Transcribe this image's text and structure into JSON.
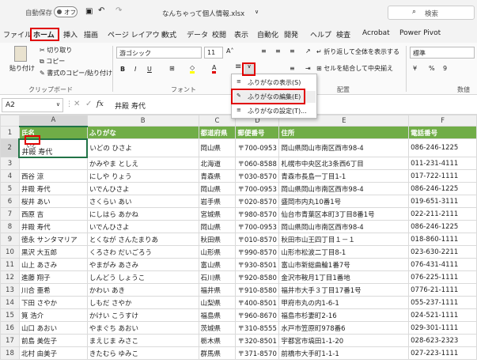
{
  "titlebar": {
    "autosave": "自動保存",
    "autosave_state": "オフ",
    "filename": "なんちゃって個人情報.xlsx",
    "search": "検索"
  },
  "menu": [
    "ファイル",
    "ホーム",
    "挿入",
    "描画",
    "ページ レイアウト",
    "数式",
    "データ",
    "校閲",
    "表示",
    "自動化",
    "開発",
    "ヘルプ",
    "検査",
    "Acrobat",
    "Power Pivot"
  ],
  "ribbon": {
    "paste": "貼り付け",
    "cut": "切り取り",
    "copy": "コピー",
    "format_painter": "書式のコピー/貼り付け",
    "clipboard": "クリップボード",
    "font_name": "游ゴシック",
    "font_size": "11",
    "font_group": "フォント",
    "align_group": "配置",
    "wrap": "折り返して全体を表示する",
    "merge": "セルを結合して中央揃え",
    "number_format": "標準",
    "number_group": "数値"
  },
  "popup": {
    "items": [
      "ふりがなの表示(S)",
      "ふりがなの編集(E)",
      "ふりがなの設定(T)..."
    ]
  },
  "formula": {
    "cellref": "A2",
    "value": "井殿 寿代"
  },
  "columns": [
    "A",
    "B",
    "C",
    "D",
    "E",
    "F"
  ],
  "headers": [
    "氏名",
    "ふりがな",
    "都道府県",
    "郵便番号",
    "住所",
    "電話番号"
  ],
  "a2_ruby": "いど",
  "rows": [
    [
      "井殿 寿代",
      "いどの ひさよ",
      "岡山県",
      "〒700-0953",
      "岡山県岡山市南区西市98-4",
      "086-246-1225"
    ],
    [
      "",
      "かみやま としえ",
      "北海道",
      "〒060-8588",
      "札幌市中央区北3条西6丁目",
      "011-231-4111"
    ],
    [
      "西谷 涼",
      "にしや りょう",
      "青森県",
      "〒030-8570",
      "青森市長島一丁目1-1",
      "017-722-1111"
    ],
    [
      "井殿 寿代",
      "いでんひさよ",
      "岡山県",
      "〒700-0953",
      "岡山県岡山市南区西市98-4",
      "086-246-1225"
    ],
    [
      "桜井 あい",
      "さくらい あい",
      "岩手県",
      "〒020-8570",
      "盛岡市内丸10番1号",
      "019-651-3111"
    ],
    [
      "西原 吉",
      "にしはら あかね",
      "宮城県",
      "〒980-8570",
      "仙台市青葉区本町3丁目8番1号",
      "022-211-2111"
    ],
    [
      "井殿 寿代",
      "いでんひさよ",
      "岡山県",
      "〒700-0953",
      "岡山県岡山市南区西市98-4",
      "086-246-1225"
    ],
    [
      "徳永 サンタマリア",
      "とくなが さんたまりあ",
      "秋田県",
      "〒010-8570",
      "秋田市山王四丁目１－１",
      "018-860-1111"
    ],
    [
      "黒沢 大五郎",
      "くろさわ だいごろう",
      "山形県",
      "〒990-8570",
      "山形市松波二丁目8-1",
      "023-630-2211"
    ],
    [
      "山上 あさみ",
      "やまがみ あさみ",
      "富山県",
      "〒930-8501",
      "富山市新総曲輪1番7号",
      "076-431-4111"
    ],
    [
      "進藤 翔子",
      "しんどう しょうこ",
      "石川県",
      "〒920-8580",
      "金沢市鞍月1丁目1番地",
      "076-225-1111"
    ],
    [
      "川合 亜希",
      "かわい あき",
      "福井県",
      "〒910-8580",
      "福井市大手３丁目17番1号",
      "0776-21-1111"
    ],
    [
      "下田 さやか",
      "しもだ さやか",
      "山梨県",
      "〒400-8501",
      "甲府市丸の内1-6-1",
      "055-237-1111"
    ],
    [
      "筧 浩介",
      "かけい こうすけ",
      "福島県",
      "〒960-8670",
      "福島市杉妻町2-16",
      "024-521-1111"
    ],
    [
      "山口 あおい",
      "やまぐち あおい",
      "茨城県",
      "〒310-8555",
      "水戸市笠原町978番6",
      "029-301-1111"
    ],
    [
      "前島 美佐子",
      "まえじま みさこ",
      "栃木県",
      "〒320-8501",
      "宇都宮市塙田1-1-20",
      "028-623-2323"
    ],
    [
      "北村 由美子",
      "きたむら ゆみこ",
      "群馬県",
      "〒371-8570",
      "前橋市大手町1-1-1",
      "027-223-1111"
    ]
  ],
  "colors": {
    "accent": "#70ad47",
    "highlight": "#e00000"
  }
}
